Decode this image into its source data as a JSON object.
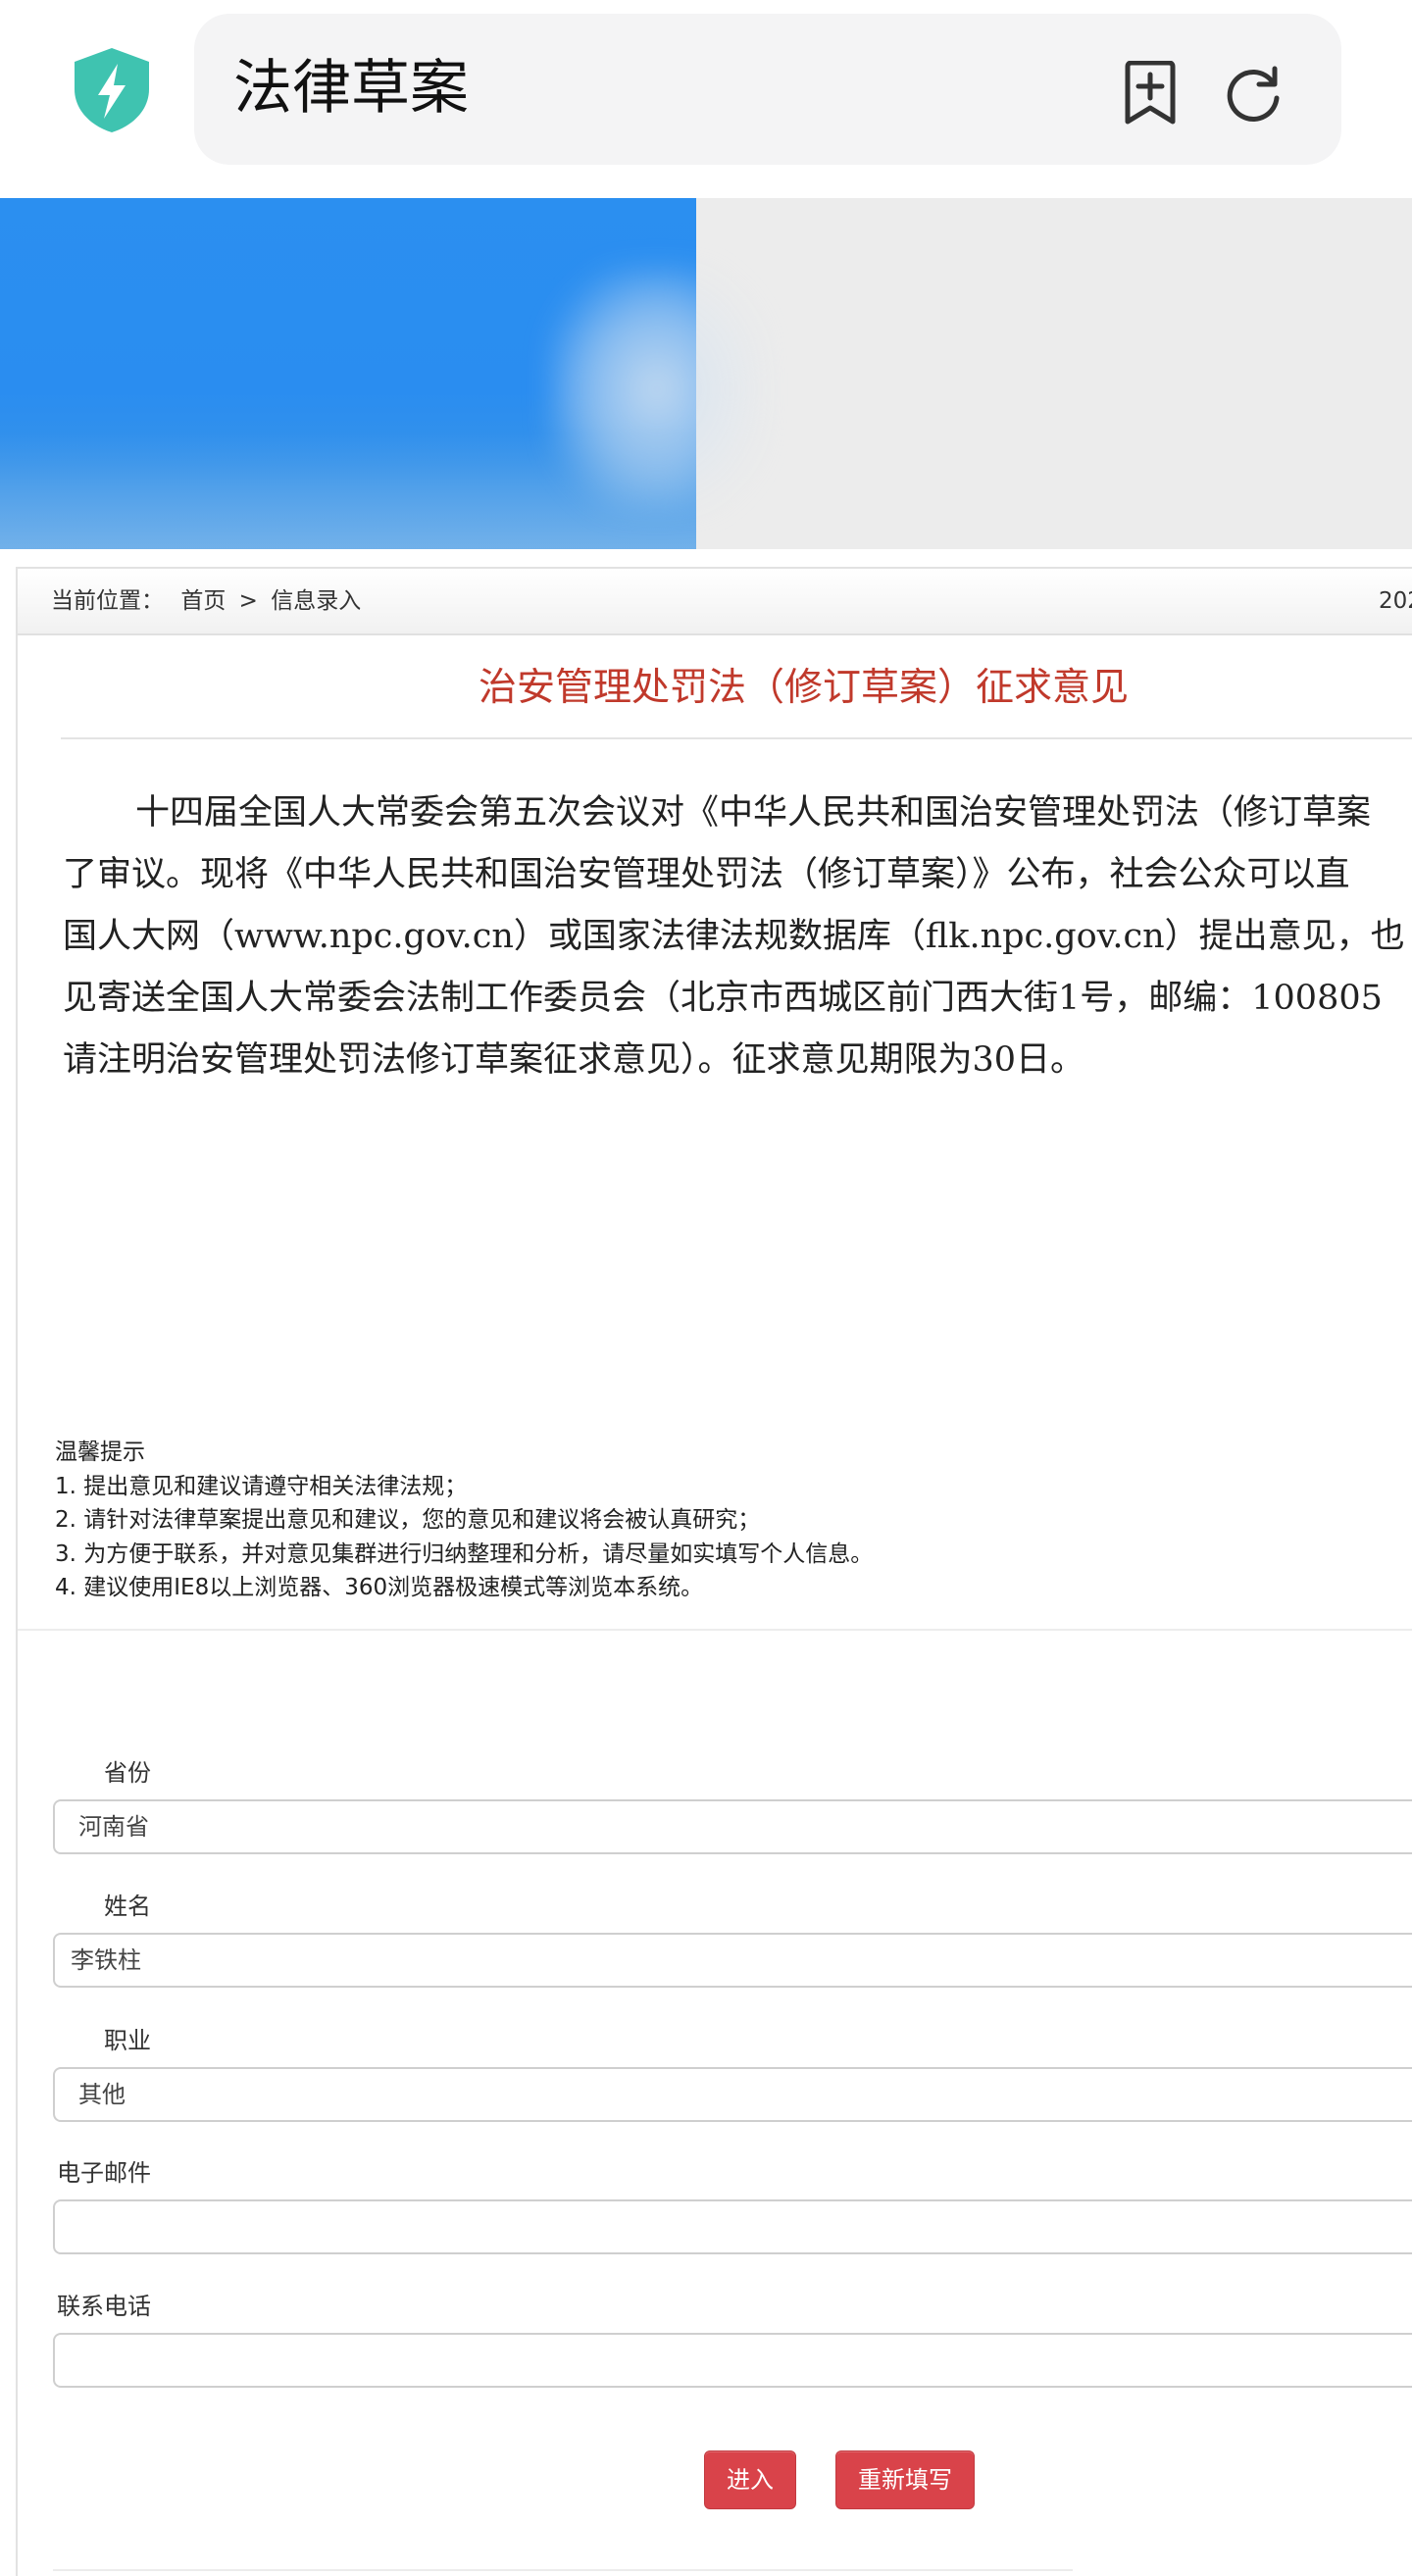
{
  "browser": {
    "address_text": "法律草案"
  },
  "breadcrumb": {
    "prefix": "当前位置：",
    "home": "首页",
    "separator": ">",
    "current": "信息录入",
    "date_partial": "202"
  },
  "notice": {
    "title": "治安管理处罚法（修订草案）征求意见",
    "lines": [
      "十四届全国人大常委会第五次会议对《中华人民共和国治安管理处罚法（修订草案",
      "了审议。现将《中华人民共和国治安管理处罚法（修订草案）》公布，社会公众可以直",
      "国人大网（www.npc.gov.cn）或国家法律法规数据库（flk.npc.gov.cn）提出意见，也",
      "见寄送全国人大常委会法制工作委员会（北京市西城区前门西大街1号，邮编：100805",
      "请注明治安管理处罚法修订草案征求意见）。征求意见期限为30日。"
    ]
  },
  "tips": {
    "heading": "温馨提示",
    "items": [
      "1. 提出意见和建议请遵守相关法律法规；",
      "2. 请针对法律草案提出意见和建议，您的意见和建议将会被认真研究；",
      "3. 为方便于联系，并对意见集群进行归纳整理和分析，请尽量如实填写个人信息。",
      "4. 建议使用IE8以上浏览器、360浏览器极速模式等浏览本系统。"
    ]
  },
  "form": {
    "province": {
      "label": "省份",
      "value": "河南省"
    },
    "name": {
      "label": "姓名",
      "value": "李铁柱"
    },
    "occupation": {
      "label": "职业",
      "value": "其他"
    },
    "email": {
      "label": "电子邮件",
      "value": ""
    },
    "phone": {
      "label": "联系电话",
      "value": ""
    },
    "submit_label": "进入",
    "reset_label": "重新填写"
  },
  "colors": {
    "shield": "#3fc3b0",
    "title_red": "#c0392b",
    "button_red": "#d9434a",
    "banner_blue": "#2b8ff0"
  }
}
